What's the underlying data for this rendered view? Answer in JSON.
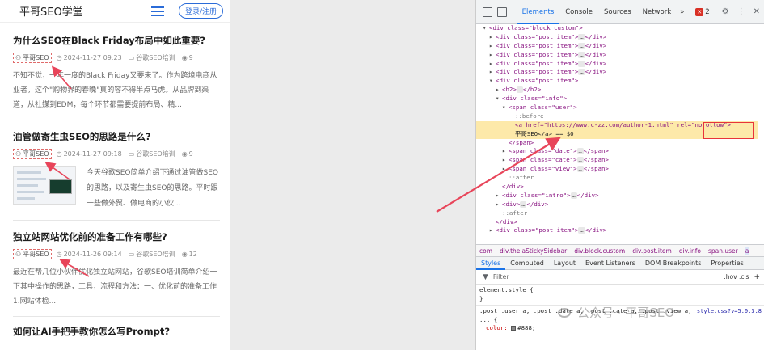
{
  "blog": {
    "site_title": "平哥SEO学堂",
    "login_label": "登录/注册",
    "posts": [
      {
        "title": "为什么SEO在Black Friday布局中如此重要?",
        "author": "平哥SEO",
        "date": "2024-11-27 09:23",
        "category": "谷歌SEO培训",
        "views": "9",
        "excerpt": "不知不觉，一年一度的Black Friday又要来了。作为跨境电商从业者，这个\"购物界的春晚\"真的容不得半点马虎。从品牌到渠道，从社媒到EDM，每个环节都需要提前布局、精..."
      },
      {
        "title": "油管做寄生虫SEO的思路是什么?",
        "author": "平哥SEO",
        "date": "2024-11-27 09:18",
        "category": "谷歌SEO培训",
        "views": "9",
        "excerpt": "今天谷歌SEO简单介绍下通过油管做SEO的思路，以及寄生虫SEO的思路。平时跟一些做外贸、做电商的小伙..."
      },
      {
        "title": "独立站网站优化前的准备工作有哪些?",
        "author": "平哥SEO",
        "date": "2024-11-26 09:14",
        "category": "谷歌SEO培训",
        "views": "12",
        "excerpt": "最近在帮几位小伙伴优化独立站网站，谷歌SEO培训简单介绍一下其中操作的思路，工具，流程和方法：一、优化前的准备工作1.网站体检..."
      },
      {
        "title": "如何让AI手把手教你怎么写Prompt?"
      }
    ]
  },
  "devtools": {
    "tabs": [
      "Elements",
      "Console",
      "Sources",
      "Network"
    ],
    "more": "»",
    "badge": "2",
    "tree": [
      {
        "indent": 9,
        "tri": "▾",
        "html": "<div class=\"block custom\">"
      },
      {
        "indent": 10,
        "tri": "▸",
        "html": "<div class=\"post item\">",
        "tail": "</div>"
      },
      {
        "indent": 10,
        "tri": "▸",
        "html": "<div class=\"post item\">",
        "tail": "</div>"
      },
      {
        "indent": 10,
        "tri": "▸",
        "html": "<div class=\"post item\">",
        "tail": "</div>"
      },
      {
        "indent": 10,
        "tri": "▸",
        "html": "<div class=\"post item\">",
        "tail": "</div>"
      },
      {
        "indent": 10,
        "tri": "▸",
        "html": "<div class=\"post item\">",
        "tail": "</div>"
      },
      {
        "indent": 10,
        "tri": "▾",
        "html": "<div class=\"post item\">"
      },
      {
        "indent": 11,
        "tri": "▸",
        "html": "<h2>",
        "tail": "</h2>"
      },
      {
        "indent": 11,
        "tri": "▾",
        "html": "<div class=\"info\">"
      },
      {
        "indent": 12,
        "tri": "▾",
        "html": "<span class=\"user\">"
      },
      {
        "indent": 13,
        "tri": "",
        "html": "::before",
        "pseudo": true
      },
      {
        "indent": 13,
        "tri": "",
        "html": "<a href=\"https://www.c-zz.com/author-1.html\" rel=\"nofollow\">",
        "selected": true
      },
      {
        "indent": 13,
        "tri": "",
        "html": "平哥SEO</a> == $0",
        "selected": true,
        "text": true
      },
      {
        "indent": 12,
        "tri": "",
        "html": "</span>"
      },
      {
        "indent": 12,
        "tri": "▸",
        "html": "<span class=\"date\">",
        "tail": "</span>"
      },
      {
        "indent": 12,
        "tri": "▸",
        "html": "<span class=\"cate\">",
        "tail": "</span>"
      },
      {
        "indent": 12,
        "tri": "▸",
        "html": "<span class=\"view\">",
        "tail": "</span>"
      },
      {
        "indent": 12,
        "tri": "",
        "html": "::after",
        "pseudo": true
      },
      {
        "indent": 11,
        "tri": "",
        "html": "</div>"
      },
      {
        "indent": 11,
        "tri": "▸",
        "html": "<div class=\"intro\">",
        "tail": "</div>"
      },
      {
        "indent": 11,
        "tri": "▸",
        "html": "<div>",
        "tail": "</div>"
      },
      {
        "indent": 11,
        "tri": "",
        "html": "::after",
        "pseudo": true
      },
      {
        "indent": 10,
        "tri": "",
        "html": "</div>"
      },
      {
        "indent": 10,
        "tri": "▸",
        "html": "<div class=\"post item\">",
        "tail": "</div>"
      }
    ],
    "crumbs": [
      "com",
      "div.theiaStickySidebar",
      "div.block.custom",
      "div.post.item",
      "div.info",
      "span.user",
      "a"
    ],
    "subtabs": [
      "Styles",
      "Computed",
      "Layout",
      "Event Listeners",
      "DOM Breakpoints",
      "Properties"
    ],
    "filter_label": "Filter",
    "filter_opts": ":hov  .cls",
    "element_style": "element.style {",
    "rule_selector": ".post .user a, .post .date a, .post .cate a, .post .view a, ... {",
    "rule_source": "style.css?v=5.0.3.8",
    "rule_prop": "color:",
    "rule_value": "#888;",
    "watermark": "公众号 · 平哥SEO"
  }
}
